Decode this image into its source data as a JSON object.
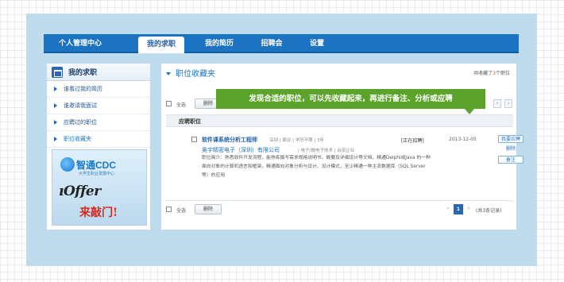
{
  "nav": {
    "tabs": [
      {
        "label": "个人管理中心"
      },
      {
        "label": "我的求职",
        "active": true
      },
      {
        "label": "我的简历"
      },
      {
        "label": "招聘会"
      },
      {
        "label": "设置"
      }
    ]
  },
  "sidebar": {
    "title": "我的求职",
    "items": [
      {
        "label": "谁看过我的简历"
      },
      {
        "label": "谁邀请我面试"
      },
      {
        "label": "应聘过的职位"
      },
      {
        "label": "职位收藏夹",
        "active": true
      }
    ],
    "banner": {
      "brand": "智通CDC",
      "brand_sub": "大学生职业发展中心",
      "headline": "ıOffer",
      "slogan": "来敲门!"
    }
  },
  "main": {
    "title": "职位收藏夹",
    "count_prefix": "共收藏了",
    "count_value": "3",
    "count_suffix": "个职位",
    "select_all_label": "全选",
    "delete_label": "删除",
    "column_job": "应聘职位",
    "prev_arrow": "‹",
    "next_arrow": "›",
    "jobs": [
      {
        "title": "软件课系统分析工程师",
        "meta": "深圳 | 面议 | 学历不限 | 3年",
        "company": "奥宇精密电子（深圳）有限公司",
        "company_meta": "| 电子/微电子技术 | 台资企业",
        "status": "[正在招聘]",
        "date": "2013-12-05",
        "desc": [
          "职位简介：熟悉软件开发流程，能熟练撰写需求规格说明书、概要及详细设计等文档，精通Delphi或Java 的一种",
          "面向对象的计算机语言和框架，精通面向对象分析与设计、设计模式，至少精通一种主流数据库（SQL Server",
          "等）的应用"
        ],
        "actions": {
          "apply": "我要应聘",
          "delete": "删除",
          "note": "备注"
        }
      }
    ],
    "pagination": {
      "current": "1",
      "summary": "(共3条记录)"
    }
  },
  "tooltip": {
    "text": "发现合适的职位，可以先收藏起来，再进行备注、分析或应聘"
  },
  "colors": {
    "nav_bg": "#1c73c2",
    "frame_bg": "#bedcee",
    "tooltip_bg": "#5ba32a",
    "link": "#1c73c2"
  }
}
